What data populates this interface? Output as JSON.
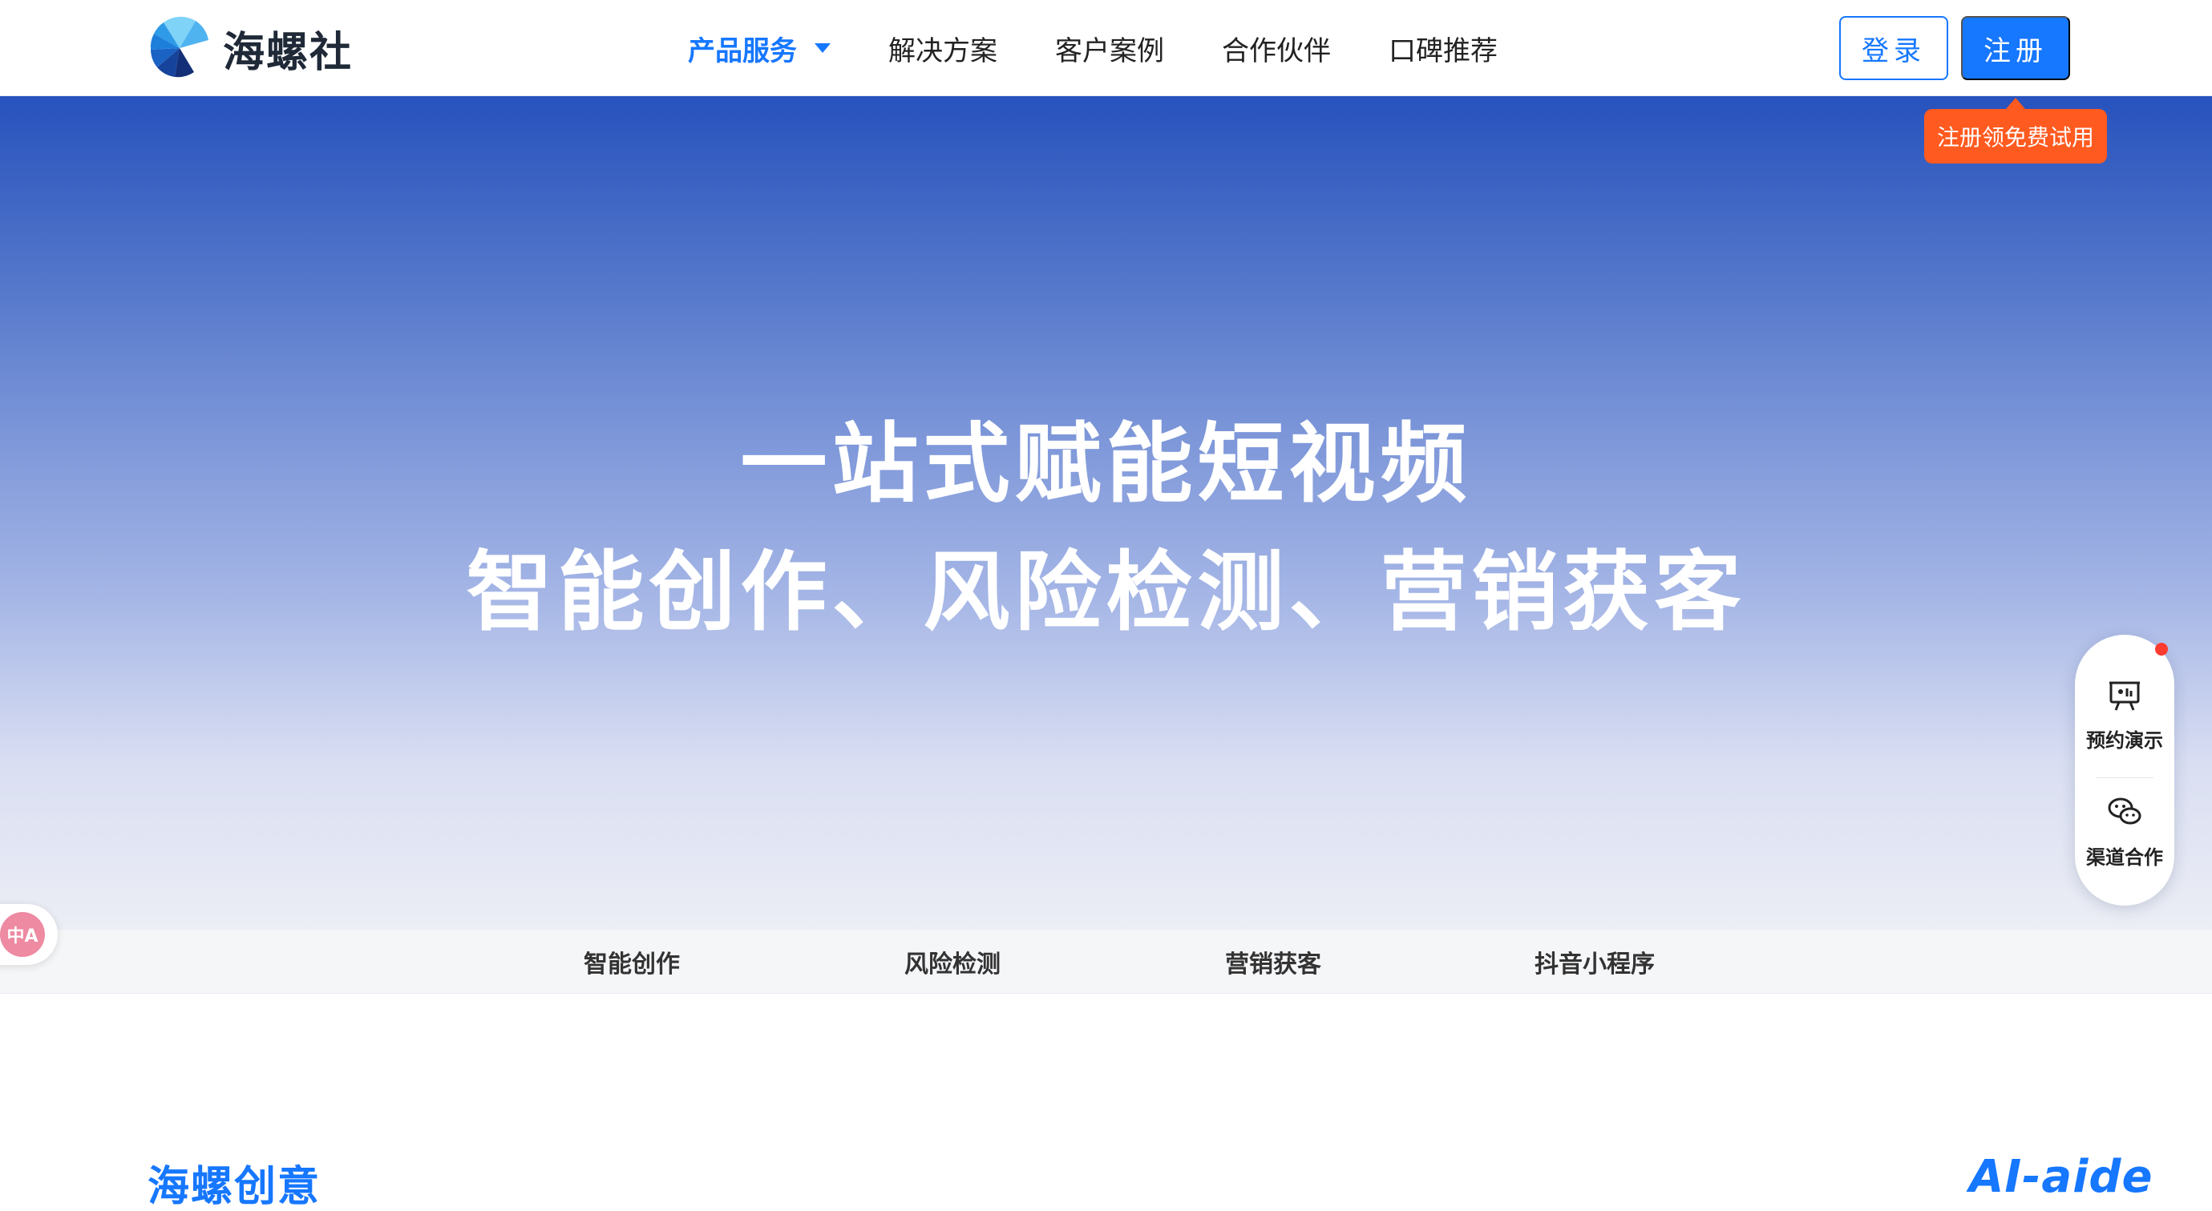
{
  "header": {
    "logo_text": "海螺社",
    "nav": [
      {
        "label": "产品服务",
        "active": true
      },
      {
        "label": "解决方案",
        "active": false
      },
      {
        "label": "客户案例",
        "active": false
      },
      {
        "label": "合作伙伴",
        "active": false
      },
      {
        "label": "口碑推荐",
        "active": false
      }
    ],
    "login_label": "登录",
    "register_label": "注册",
    "promo_tip": "注册领免费试用"
  },
  "hero": {
    "line1": "一站式赋能短视频",
    "line2": "智能创作、风险检测、营销获客"
  },
  "product_tabs": [
    "智能创作",
    "风险检测",
    "营销获客",
    "抖音小程序"
  ],
  "side_panel": {
    "items": [
      {
        "label": "预约演示",
        "icon": "presentation-icon"
      },
      {
        "label": "渠道合作",
        "icon": "wechat-icon"
      }
    ]
  },
  "translate_badge": {
    "icon": "translate-icon",
    "glyph": "中A"
  },
  "section": {
    "title": "海螺创意",
    "brand": "AI-aide"
  },
  "colors": {
    "primary": "#1677ff",
    "promo": "#ff5a1f",
    "hero_top": "#2752bd",
    "hero_bottom": "#eceef5"
  }
}
